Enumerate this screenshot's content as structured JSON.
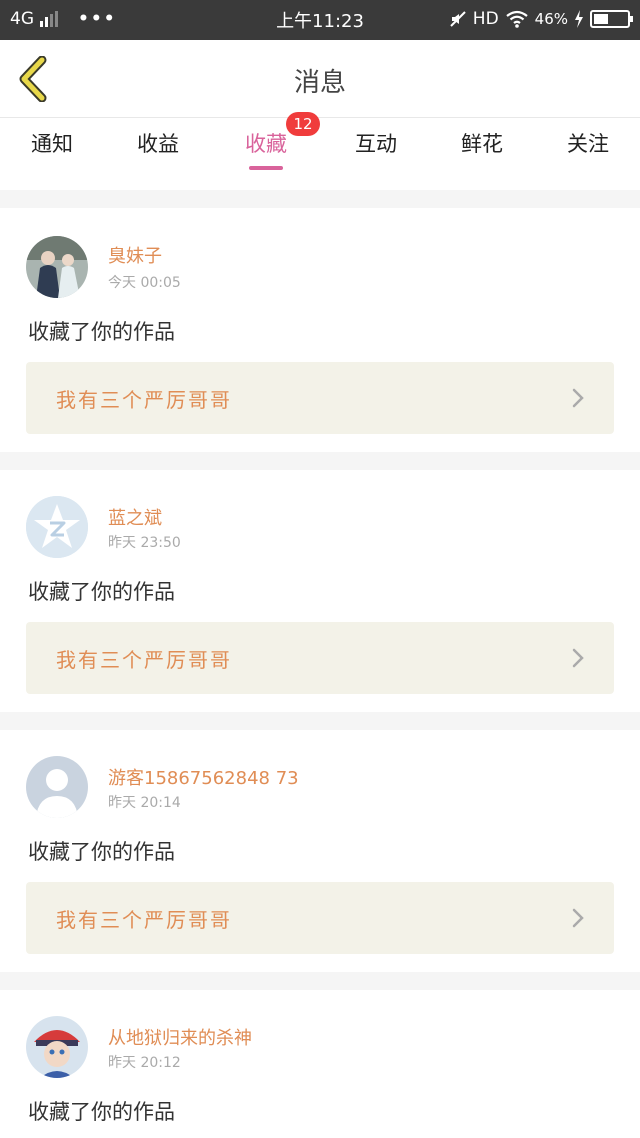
{
  "status_bar": {
    "network": "4G",
    "more": "•••",
    "time": "上午11:23",
    "hd": "HD",
    "battery": "46%"
  },
  "header": {
    "title": "消息"
  },
  "tabs": [
    {
      "label": "通知"
    },
    {
      "label": "收益"
    },
    {
      "label": "收藏",
      "badge": "12",
      "active": true
    },
    {
      "label": "互动"
    },
    {
      "label": "鲜花"
    },
    {
      "label": "关注"
    }
  ],
  "messages": [
    {
      "user": "臭妹子",
      "time": "今天 00:05",
      "action": "收藏了你的作品",
      "work": "我有三个严厉哥哥",
      "avatar": "photo-avatar-icon"
    },
    {
      "user": "蓝之斌",
      "time": "昨天 23:50",
      "action": "收藏了你的作品",
      "work": "我有三个严厉哥哥",
      "avatar": "qzone-avatar-icon"
    },
    {
      "user": "游客15867562848 73",
      "time": "昨天 20:14",
      "action": "收藏了你的作品",
      "work": "我有三个严厉哥哥",
      "avatar": "default-user-avatar-icon"
    },
    {
      "user": "从地狱归来的杀神",
      "time": "昨天 20:12",
      "action": "收藏了你的作品",
      "avatar": "cartoon-avatar-icon"
    }
  ],
  "colors": {
    "accent": "#d9639b",
    "name": "#e08d55",
    "badge": "#f03c3c"
  }
}
